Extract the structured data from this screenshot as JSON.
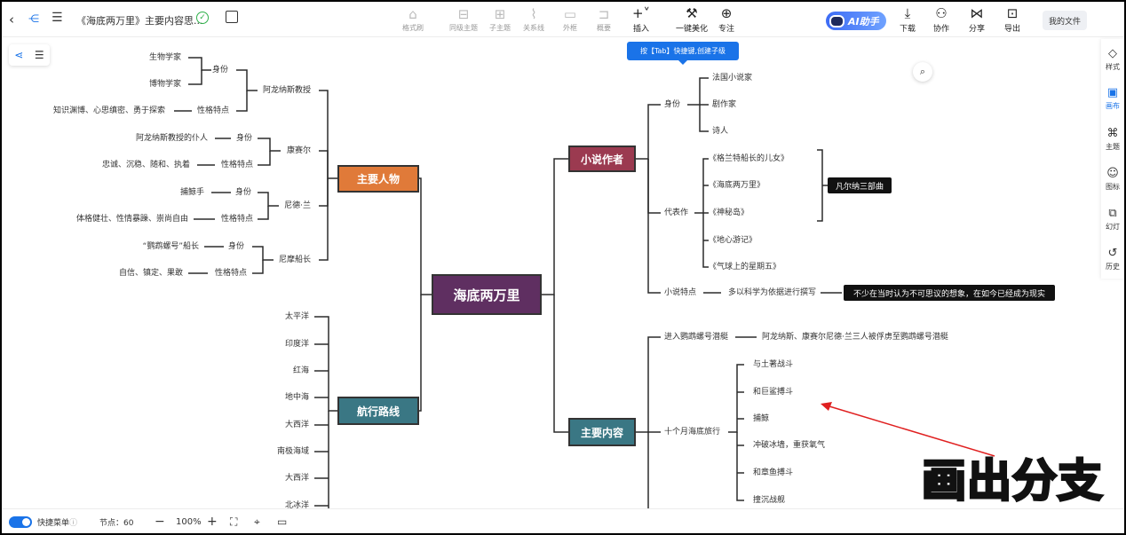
{
  "toolbar": {
    "doc_title": "《海底两万里》主要内容思...",
    "format_brush": "格式刷",
    "sibling_topic": "同级主题",
    "child_topic": "子主题",
    "relation_line": "关系线",
    "outer_frame": "外框",
    "summary": "概要",
    "insert": "插入",
    "beautify": "一键美化",
    "focus": "专注",
    "ai_label": "AI助手",
    "download": "下载",
    "collab": "协作",
    "share": "分享",
    "export": "导出",
    "my_files": "我的文件"
  },
  "tab_tip": "按【Tab】快捷键,创建子级",
  "right_panel": {
    "style": "样式",
    "canvas": "画布",
    "theme": "主题",
    "icon": "图标",
    "slides": "幻灯",
    "history": "历史"
  },
  "status": {
    "shortcut_menu": "快捷菜单",
    "node_count": "节点：60",
    "zoom": "100%"
  },
  "overlay_text": "画出分支",
  "map": {
    "root": "海底两万里",
    "main_chars": "主要人物",
    "route": "航行路线",
    "novelist": "小说作者",
    "main_content": "主要内容",
    "aronnax": "阿龙纳斯教授",
    "conseil": "康赛尔",
    "ned": "尼德·兰",
    "nemo": "尼摩船长",
    "identity": "身份",
    "traits": "性格特点",
    "biologist": "生物学家",
    "naturalist": "博物学家",
    "aronnax_traits": "知识渊博、心思缜密、勇于探索",
    "conseil_id": "阿龙纳斯教授的仆人",
    "conseil_traits": "忠诚、沉稳、随和、执着",
    "ned_id": "捕鲸手",
    "ned_traits": "体格健壮、性情暴躁、崇尚自由",
    "nemo_id": "“鹦鹉螺号”船长",
    "nemo_traits": "自信、镇定、果敢",
    "seas": [
      "太平洋",
      "印度洋",
      "红海",
      "地中海",
      "大西洋",
      "南极海域",
      "大西洋",
      "北冰洋"
    ],
    "author_identity": "身份",
    "author_ids": [
      "法国小说家",
      "剧作家",
      "诗人"
    ],
    "works_label": "代表作",
    "works": [
      "《格兰特船长的儿女》",
      "《海底两万里》",
      "《神秘岛》",
      "《地心游记》",
      "《气球上的星期五》"
    ],
    "trilogy": "凡尔纳三部曲",
    "novel_traits": "小说特点",
    "novel_traits_desc": "多以科学为依据进行撰写",
    "novel_traits_note": "不少在当时认为不可思议的想象，在如今已经成为现实",
    "enter_sub": "进入鹦鹉螺号潜艇",
    "enter_sub_desc": "阿龙纳斯、康赛尔尼德·兰三人被俘虏至鹦鹉螺号潜艇",
    "travel": "十个月海底旅行",
    "events": [
      "与土著战斗",
      "和巨鲨搏斗",
      "捕鲸",
      "冲破冰墙，重获氧气",
      "和章鱼搏斗",
      "撞沉战舰"
    ]
  },
  "colors": {
    "main_chars": "#e07a39",
    "route": "#3a7784",
    "novelist": "#9b3a50",
    "main_content": "#3a7784",
    "root": "#5f2f61",
    "accent": "#1a73e8"
  }
}
